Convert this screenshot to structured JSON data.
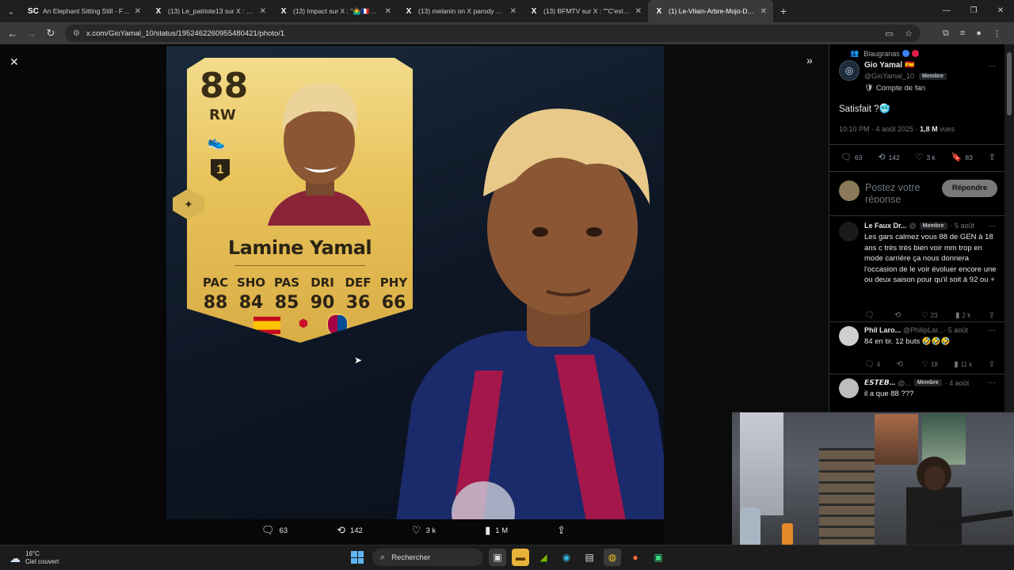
{
  "browser": {
    "tabs": [
      {
        "favicon": "SC",
        "title": "An Elephant Sitting Still - Film (",
        "active": false
      },
      {
        "favicon": "X",
        "title": "(13) Le_patriote13 sur X : \"Salle",
        "active": false
      },
      {
        "favicon": "X",
        "title": "(13) Impact sur X : \"🤷‍♂️🇫🇷🤮🔥",
        "active": false
      },
      {
        "favicon": "X",
        "title": "(13) melanin on X parody accou",
        "active": false
      },
      {
        "favicon": "X",
        "title": "(13) BFMTV sur X : \"\"C'est une ca",
        "active": false
      },
      {
        "favicon": "X",
        "title": "(1) Le-Vilain-Arbre-Mojo-D'Hyr",
        "active": true
      }
    ],
    "url": "x.com/GioYamal_10/status/1952462260955480421/photo/1"
  },
  "card": {
    "rating": "88",
    "position": "RW",
    "rank": "1",
    "name": "Lamine Yamal",
    "stats": [
      {
        "label": "PAC",
        "value": "88"
      },
      {
        "label": "SHO",
        "value": "84"
      },
      {
        "label": "PAS",
        "value": "85"
      },
      {
        "label": "DRI",
        "value": "90"
      },
      {
        "label": "DEF",
        "value": "36"
      },
      {
        "label": "PHY",
        "value": "66"
      }
    ]
  },
  "photo_actions": {
    "replies": "63",
    "reposts": "142",
    "likes": "3 k",
    "views": "1 M"
  },
  "tweet": {
    "community": "Blaugranas",
    "author_name": "Gio Yamal 🇪🇸",
    "author_handle": "@GioYamal_10",
    "member_badge": "Membre",
    "fan_label": "Compte de fan",
    "text": "Satisfait ?🥶",
    "time": "10:10 PM · 4 août 2025 ·",
    "views_count": "1,8 M",
    "views_label": "vues",
    "replies": "63",
    "reposts": "142",
    "likes": "3 k",
    "bookmarks": "83",
    "reply_placeholder": "Postez votre réponse",
    "reply_button": "Répondre"
  },
  "replies": [
    {
      "name": "Le Faux Dr...",
      "handle": "@",
      "badge": "Membre",
      "date": "· 5 août",
      "text": "Les gars calmez vous 88 de GEN à 18 ans c très très bien voir mm trop en mode carrière ça nous donnera l'occasion de le voir évoluer encore une ou deux saison pour qu'il soit à 92 ou +",
      "replies": "",
      "reposts": "",
      "likes": "23",
      "views": "2 k",
      "avatar_color": "#1a1a1a"
    },
    {
      "name": "Phil Laro...",
      "handle": "@PhilipLar...",
      "badge": "",
      "date": "· 5 août",
      "text": "84 en tir. 12 buts 🤣🤣🤣",
      "replies": "4",
      "reposts": "",
      "likes": "18",
      "views": "11 k",
      "avatar_color": "#cfcfcf"
    },
    {
      "name": "𝙀𝙎𝙏𝙀𝘽...",
      "handle": "@...",
      "badge": "Membre",
      "date": "· 4 août",
      "text": "il a que 88 ???",
      "replies": "",
      "reposts": "",
      "likes": "",
      "views": "",
      "avatar_color": "#bdbdbd"
    }
  ],
  "taskbar": {
    "temperature": "16°C",
    "weather": "Ciel couvert",
    "search_label": "Rechercher"
  },
  "colors": {
    "accent_gold": "#e8c25a",
    "x_background": "#000000",
    "reply_button": "#787a7a"
  }
}
